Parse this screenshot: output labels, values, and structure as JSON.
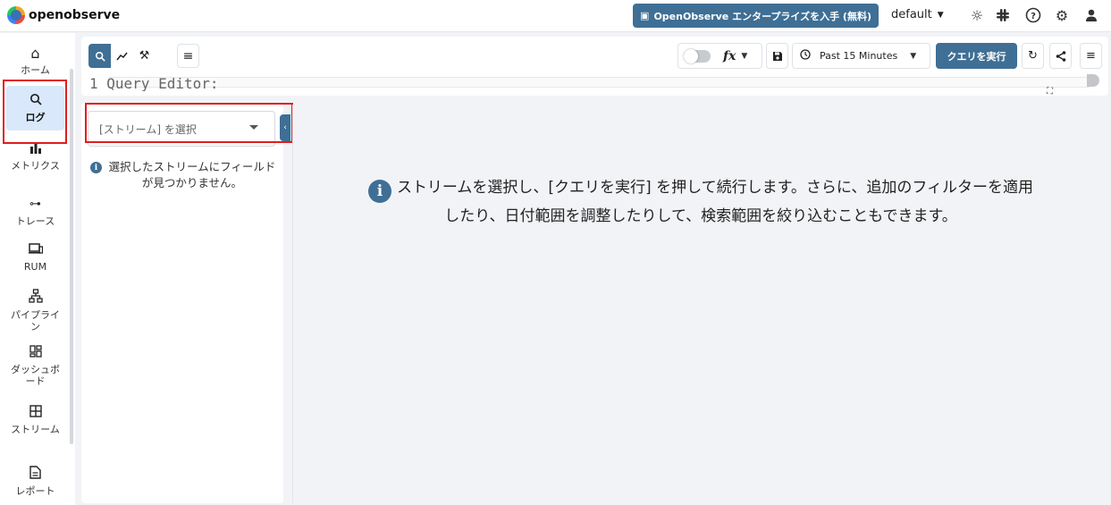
{
  "brand": {
    "name": "openobserve"
  },
  "header": {
    "enterprise_label": "OpenObserve エンタープライズを入手 (無料)",
    "org": "default",
    "icons": [
      "sun-icon",
      "slack-icon",
      "help-icon",
      "gear-icon",
      "user-icon"
    ]
  },
  "nav": {
    "items": [
      {
        "id": "home",
        "icon": "home-icon",
        "label": "ホーム"
      },
      {
        "id": "logs",
        "icon": "search-icon",
        "label": "ログ",
        "active": true
      },
      {
        "id": "metrics",
        "icon": "bar-chart-icon",
        "label": "メトリクス"
      },
      {
        "id": "traces",
        "icon": "trace-icon",
        "label": "トレース"
      },
      {
        "id": "rum",
        "icon": "devices-icon",
        "label": "RUM"
      },
      {
        "id": "pipelines",
        "icon": "pipeline-icon",
        "label": "パイプライン"
      },
      {
        "id": "dashboards",
        "icon": "dashboard-icon",
        "label": "ダッシュボード"
      },
      {
        "id": "streams",
        "icon": "grid-icon",
        "label": "ストリーム"
      },
      {
        "id": "reports",
        "icon": "document-icon",
        "label": "レポート"
      }
    ]
  },
  "toolbar": {
    "editor_label": "1 Query Editor:",
    "fx_label": "fx",
    "time_range": "Past 15 Minutes",
    "run_label": "クエリを実行"
  },
  "streams": {
    "placeholder": "[ストリーム] を選択",
    "no_fields": "選択したストリームにフィールドが見つかりません。"
  },
  "main": {
    "message": "ストリームを選択し、[クエリを実行] を押して続行します。さらに、追加のフィルターを適用したり、日付範囲を調整したりして、検索範囲を絞り込むこともできます。"
  },
  "colors": {
    "accent": "#3f6f95",
    "highlight": "#e11d1d",
    "active_nav": "#d9e8fb"
  }
}
